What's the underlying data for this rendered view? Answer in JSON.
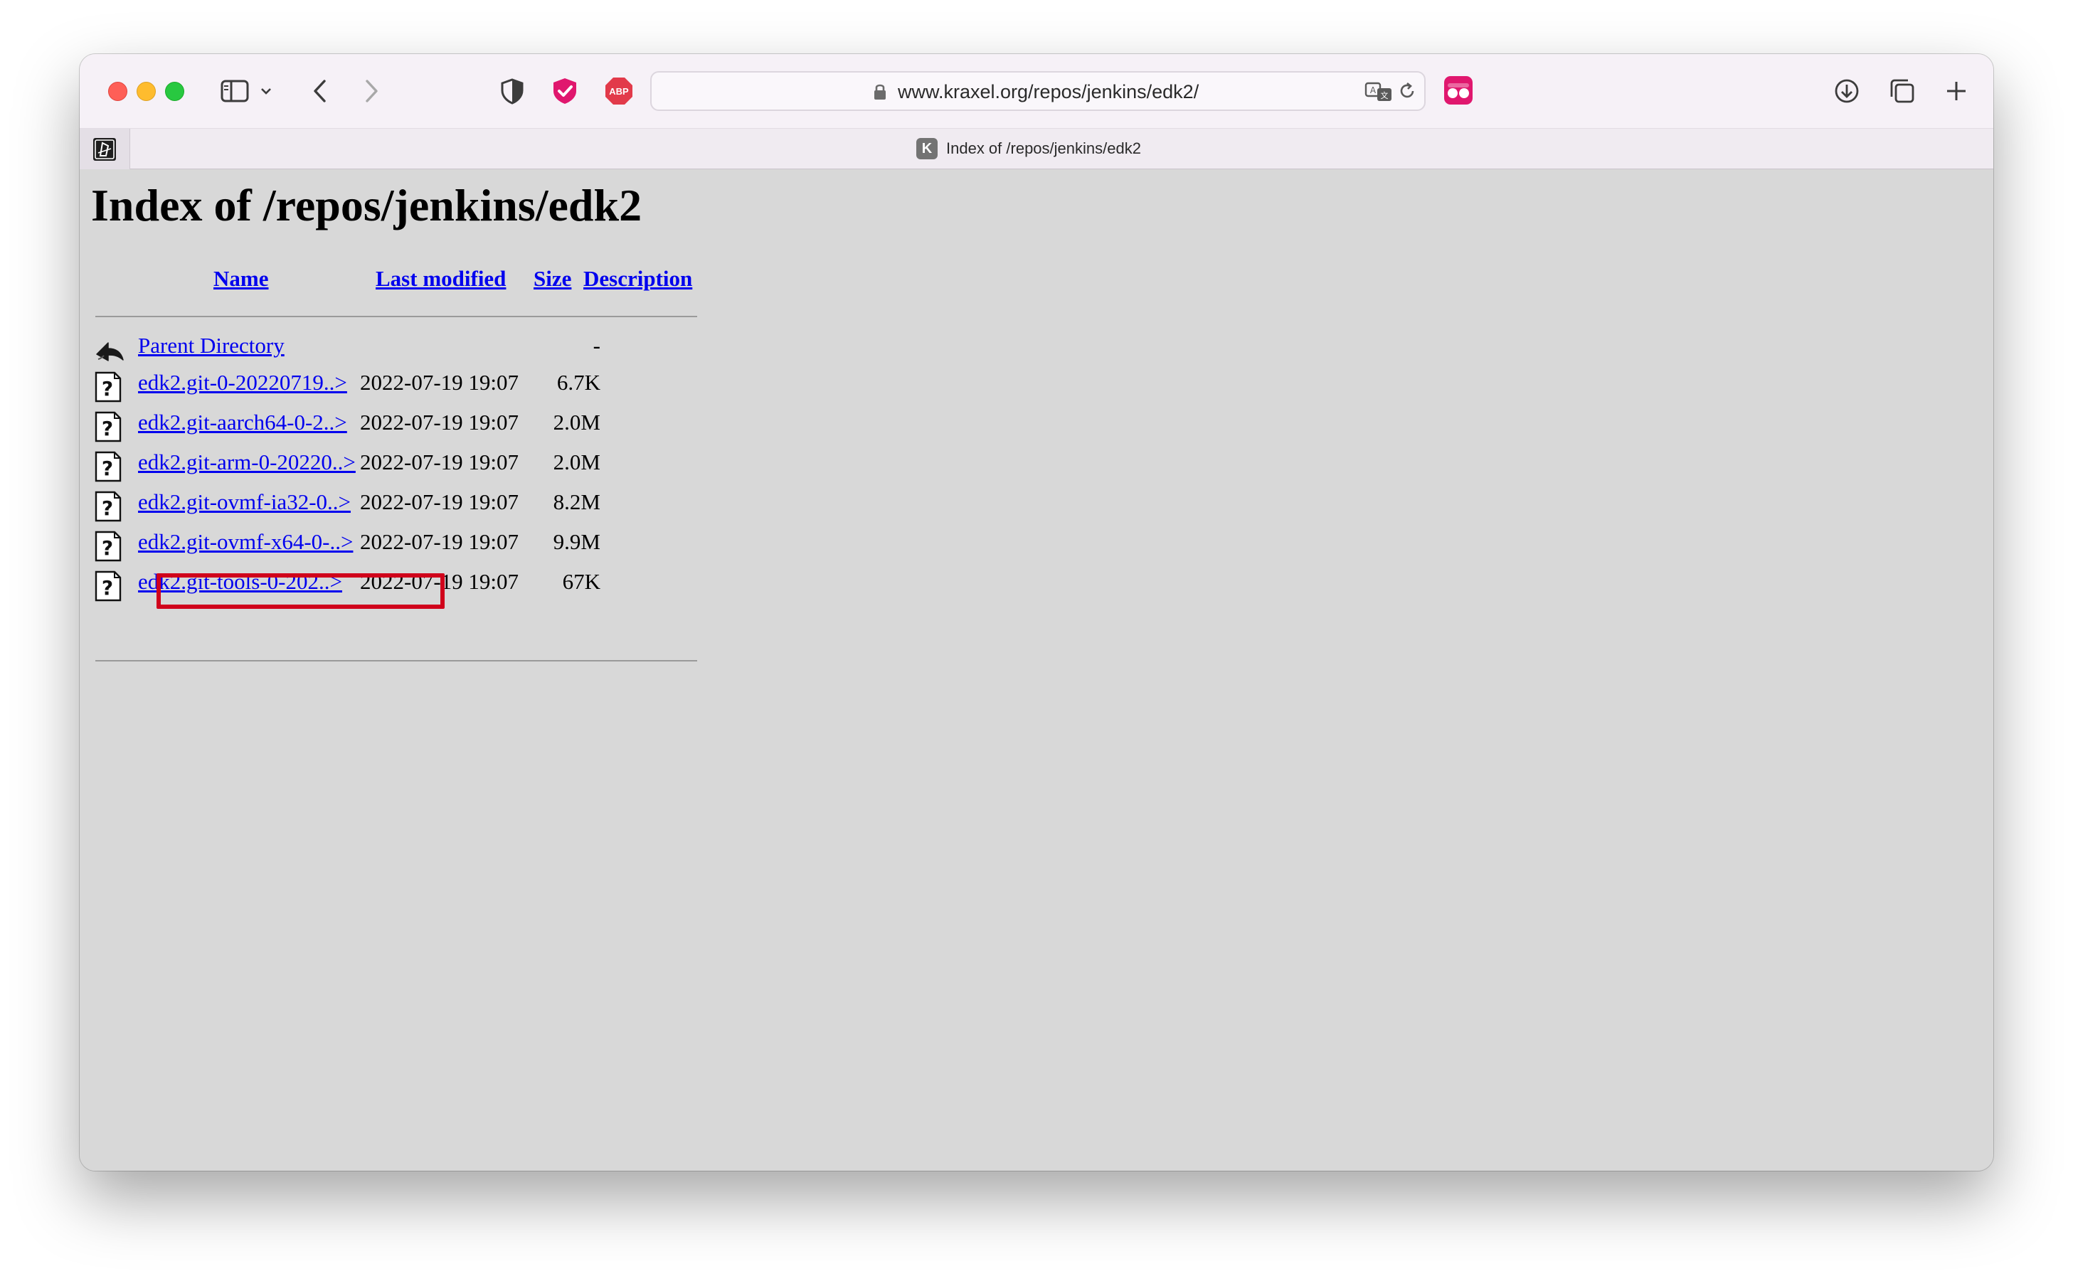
{
  "browser": {
    "url": "www.kraxel.org/repos/jenkins/edk2/",
    "tab_title": "Index of /repos/jenkins/edk2",
    "tab_favicon_letter": "K",
    "abp_label": "ABP",
    "colors": {
      "close": "#fe5f57",
      "minimize": "#febc2e",
      "maximize": "#28c840",
      "toolbar_bg": "#f6f1f7",
      "extension_pink": "#e0176e"
    }
  },
  "page": {
    "title": "Index of /repos/jenkins/edk2",
    "columns": {
      "name": "Name",
      "last_modified": "Last modified",
      "size": "Size",
      "description": "Description"
    },
    "parent": {
      "label": "Parent Directory",
      "size": "-"
    },
    "rows": [
      {
        "name": "edk2.git-0-20220719..>",
        "modified": "2022-07-19 19:07",
        "size": "6.7K"
      },
      {
        "name": "edk2.git-aarch64-0-2..>",
        "modified": "2022-07-19 19:07",
        "size": "2.0M"
      },
      {
        "name": "edk2.git-arm-0-20220..>",
        "modified": "2022-07-19 19:07",
        "size": "2.0M"
      },
      {
        "name": "edk2.git-ovmf-ia32-0..>",
        "modified": "2022-07-19 19:07",
        "size": "8.2M"
      },
      {
        "name": "edk2.git-ovmf-x64-0-..>",
        "modified": "2022-07-19 19:07",
        "size": "9.9M"
      },
      {
        "name": "edk2.git-tools-0-202..>",
        "modified": "2022-07-19 19:07",
        "size": "67K"
      }
    ],
    "highlighted_row": 1,
    "link_color": "#0000ee",
    "highlight_color": "#d0021b"
  }
}
